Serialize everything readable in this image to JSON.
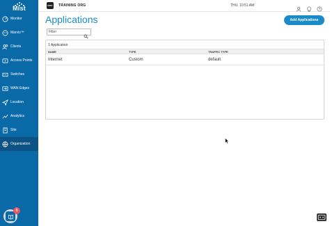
{
  "sidebar": {
    "logo_text": "Mist",
    "items": [
      {
        "label": "Monitor",
        "icon": "monitor-icon",
        "active": false
      },
      {
        "label": "Marvis™",
        "icon": "marvis-icon",
        "active": false
      },
      {
        "label": "Clients",
        "icon": "clients-icon",
        "active": false
      },
      {
        "label": "Access Points",
        "icon": "access-point-icon",
        "active": false
      },
      {
        "label": "Switches",
        "icon": "switch-icon",
        "active": false
      },
      {
        "label": "WAN Edges",
        "icon": "wan-edge-icon",
        "active": false
      },
      {
        "label": "Location",
        "icon": "location-icon",
        "active": false
      },
      {
        "label": "Analytics",
        "icon": "analytics-icon",
        "active": false
      },
      {
        "label": "Site",
        "icon": "site-icon",
        "active": false
      },
      {
        "label": "Organization",
        "icon": "organization-icon",
        "active": true
      }
    ],
    "help_badge": "6"
  },
  "topbar": {
    "org_badge": "MIST",
    "org_name": "TRAINING ORG",
    "clock": "THU, 10:51 AM"
  },
  "main": {
    "title": "Applications",
    "add_button": "Add Applications",
    "filter_placeholder": "Filter",
    "count": "1 Application",
    "columns": [
      "NAME",
      "TYPE",
      "TRAFFIC TYPE"
    ],
    "rows": [
      {
        "name": "Internet",
        "type": "Custom",
        "traffic_type": "default"
      }
    ]
  },
  "colors": {
    "sidebar": "#0a6aa8",
    "sidebar_active": "#0d5284",
    "accent": "#1a8ac9"
  }
}
